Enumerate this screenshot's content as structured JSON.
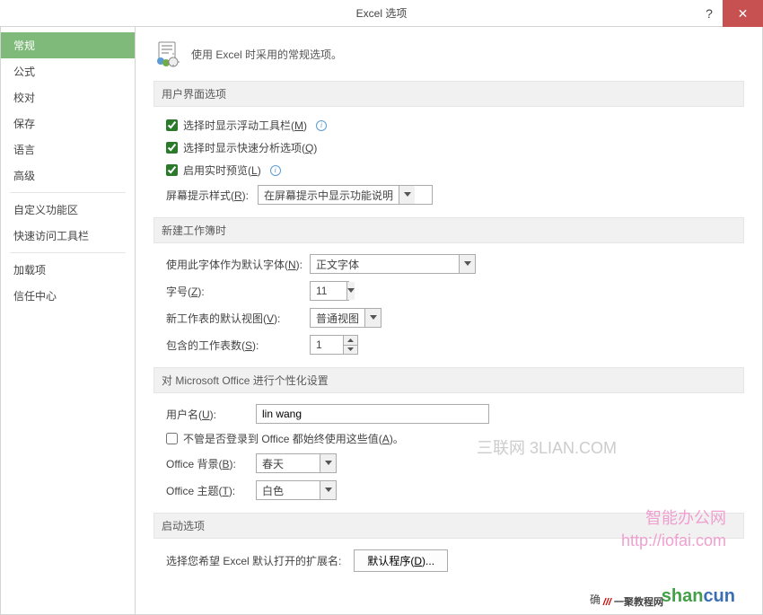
{
  "titlebar": {
    "title": "Excel 选项",
    "help": "?",
    "close": "✕"
  },
  "sidebar": {
    "items": [
      {
        "label": "常规",
        "active": true
      },
      {
        "label": "公式"
      },
      {
        "label": "校对"
      },
      {
        "label": "保存"
      },
      {
        "label": "语言"
      },
      {
        "label": "高级"
      },
      {
        "sep": true
      },
      {
        "label": "自定义功能区"
      },
      {
        "label": "快速访问工具栏"
      },
      {
        "sep": true
      },
      {
        "label": "加载项"
      },
      {
        "label": "信任中心"
      }
    ]
  },
  "header": {
    "text": "使用 Excel 时采用的常规选项。"
  },
  "sections": {
    "ui": {
      "title": "用户界面选项",
      "cb_mini_toolbar": "选择时显示浮动工具栏(M)",
      "cb_quick_analysis": "选择时显示快速分析选项(Q)",
      "cb_live_preview": "启用实时预览(L)",
      "screentip_label": "屏幕提示样式(R):",
      "screentip_value": "在屏幕提示中显示功能说明"
    },
    "new_wb": {
      "title": "新建工作簿时",
      "font_label": "使用此字体作为默认字体(N):",
      "font_value": "正文字体",
      "size_label": "字号(Z):",
      "size_value": "11",
      "view_label": "新工作表的默认视图(V):",
      "view_value": "普通视图",
      "sheets_label": "包含的工作表数(S):",
      "sheets_value": "1"
    },
    "personalize": {
      "title": "对 Microsoft Office 进行个性化设置",
      "username_label": "用户名(U):",
      "username_value": "lin wang",
      "cb_always_use": "不管是否登录到 Office 都始终使用这些值(A)。",
      "bg_label": "Office 背景(B):",
      "bg_value": "春天",
      "theme_label": "Office 主题(T):",
      "theme_value": "白色"
    },
    "startup": {
      "title": "启动选项",
      "ext_label": "选择您希望 Excel 默认打开的扩展名:",
      "ext_button": "默认程序(D)..."
    }
  },
  "footer": {
    "ok": "确"
  },
  "watermarks": {
    "w1": "三联网 3LIAN.COM",
    "w2_line1": "智能办公网",
    "w2_line2": "http://iofai.com",
    "w3": "shancun",
    "w4": "一聚教程网"
  }
}
